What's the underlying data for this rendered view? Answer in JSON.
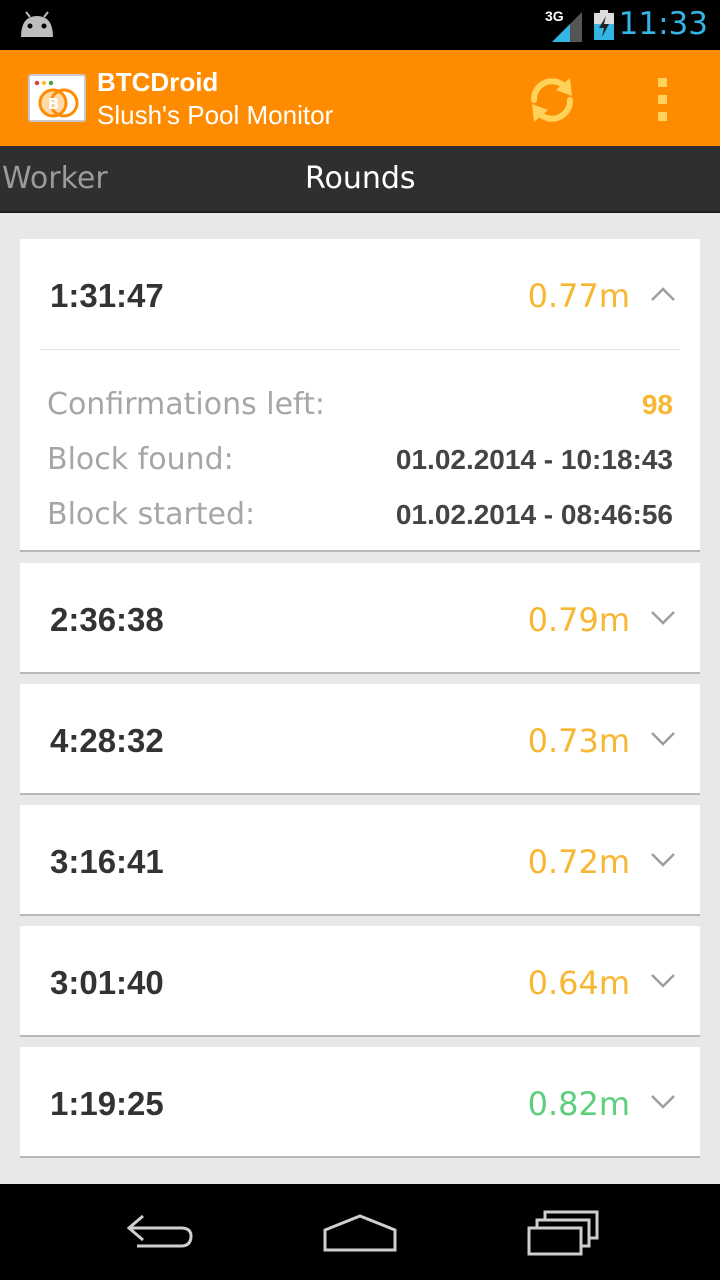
{
  "status_bar": {
    "network": "3G",
    "time": "11:33",
    "time_color": "#33b5e5",
    "icons": [
      "android-icon",
      "signal-icon",
      "battery-charging-icon"
    ]
  },
  "action_bar": {
    "title": "BTCDroid",
    "subtitle": "Slush's Pool Monitor",
    "background": "#ff8c00",
    "actions": [
      "refresh-icon",
      "overflow-menu-icon"
    ]
  },
  "tabs": [
    {
      "label": "Worker",
      "selected": false
    },
    {
      "label": "Rounds",
      "selected": true
    }
  ],
  "rounds": [
    {
      "duration": "1:31:47",
      "reward": "0.77m",
      "reward_color": "#f7b733",
      "expanded": true,
      "details": [
        {
          "label": "Confirmations left:",
          "value": "98"
        },
        {
          "label": "Block found:",
          "value": "01.02.2014 - 10:18:43"
        },
        {
          "label": "Block started:",
          "value": "01.02.2014 - 08:46:56"
        }
      ]
    },
    {
      "duration": "2:36:38",
      "reward": "0.79m",
      "reward_color": "#f7b733",
      "expanded": false
    },
    {
      "duration": "4:28:32",
      "reward": "0.73m",
      "reward_color": "#f7b733",
      "expanded": false
    },
    {
      "duration": "3:16:41",
      "reward": "0.72m",
      "reward_color": "#f7b733",
      "expanded": false
    },
    {
      "duration": "3:01:40",
      "reward": "0.64m",
      "reward_color": "#f7b733",
      "expanded": false
    },
    {
      "duration": "1:19:25",
      "reward": "0.82m",
      "reward_color": "#5dcf7d",
      "expanded": false
    }
  ],
  "nav_bar": {
    "buttons": [
      "back-icon",
      "home-icon",
      "recent-apps-icon"
    ]
  }
}
